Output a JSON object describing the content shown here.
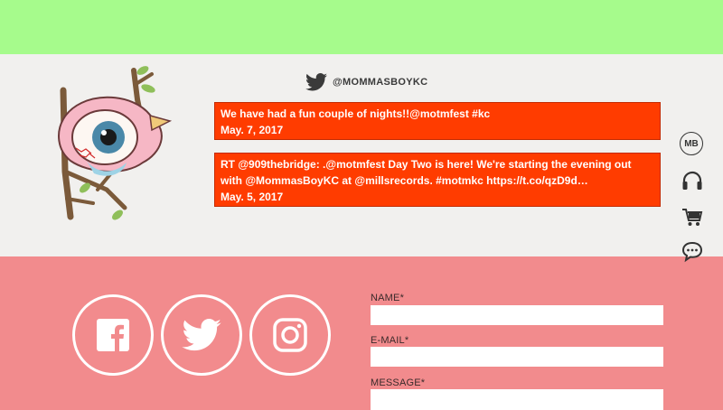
{
  "twitter": {
    "handle": "@MOMMASBOYKC",
    "tweets": [
      {
        "text": "We have had a fun couple of nights!!@motmfest #kc",
        "date": "May. 7, 2017"
      },
      {
        "text": "RT @909thebridge: .@motmfest Day Two is here! We're starting the evening out with @MommasBoyKC at @millsrecords. #motmkc https://t.co/qzD9d…",
        "date": "May. 5, 2017"
      }
    ]
  },
  "side_nav": {
    "mb_label": "MB",
    "items": [
      "mb-logo-icon",
      "headphones-icon",
      "cart-icon",
      "chat-icon"
    ]
  },
  "social": [
    "facebook-icon",
    "twitter-icon",
    "instagram-icon"
  ],
  "contact_form": {
    "name_label": "NAME*",
    "name_value": "",
    "email_label": "E-MAIL*",
    "email_value": "",
    "message_label": "MESSAGE*",
    "message_value": ""
  },
  "colors": {
    "top_band": "#a6fb8c",
    "feed_band": "#f1f0ee",
    "contact_band": "#f28b8d",
    "tweet_bg": "#ff3c00"
  }
}
